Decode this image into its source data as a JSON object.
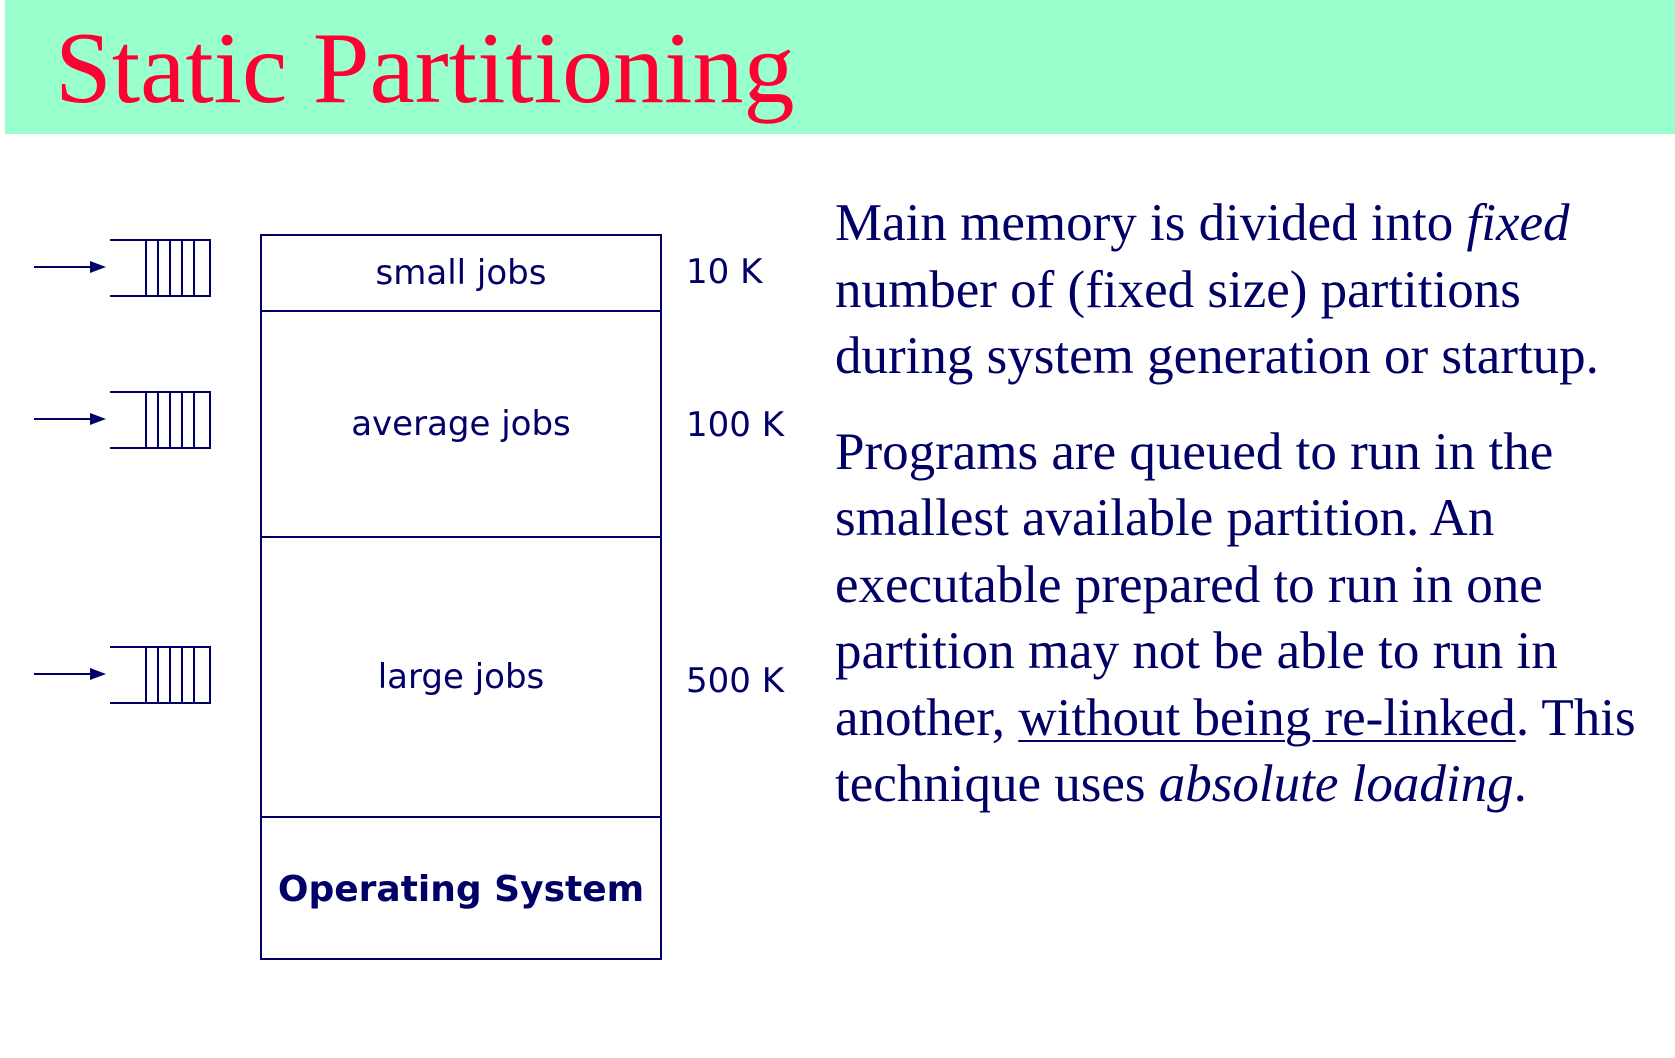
{
  "slide": {
    "title": "Static Partitioning",
    "colors": {
      "title_bar": "#99ffcc",
      "title_text": "#ff0033",
      "diagram": "#000066",
      "body_text": "#000066"
    }
  },
  "diagram": {
    "partitions": [
      {
        "label": "small jobs",
        "size": "10 K",
        "has_queue": true
      },
      {
        "label": "average jobs",
        "size": "100 K",
        "has_queue": true
      },
      {
        "label": "large jobs",
        "size": "500 K",
        "has_queue": true
      },
      {
        "label": "Operating System",
        "size": "",
        "has_queue": false
      }
    ],
    "queue_icon": "arrow-into-queue-icon"
  },
  "description": {
    "p1_a": "Main memory is divided into ",
    "p1_b": "fixed",
    "p1_c": " number of (fixed size) partitions during system generation or startup.",
    "p2_a": "Programs are queued to run in the smallest available partition. An executable prepared to run in one partition may not be able to run in another, ",
    "p2_b": "without being re-linked",
    "p2_c": ". This technique uses ",
    "p2_d": "absolute loading",
    "p2_e": "."
  }
}
